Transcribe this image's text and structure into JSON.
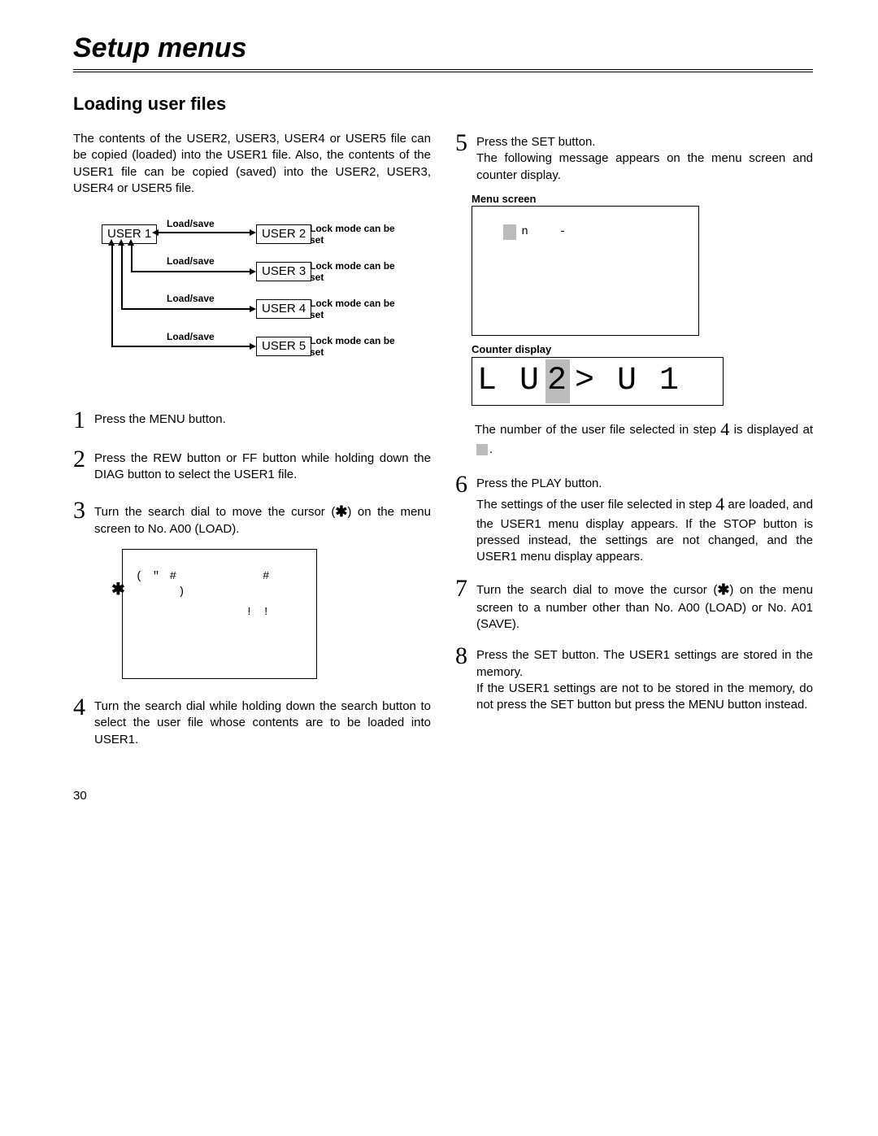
{
  "page_number": "30",
  "header": {
    "title": "Setup menus"
  },
  "section": {
    "title": "Loading user files"
  },
  "intro": "The contents of the USER2, USER3, USER4 or USER5 file can be copied (loaded) into the USER1 file. Also, the contents of the USER1 file can be copied (saved) into the USER2, USER3, USER4 or USER5 file.",
  "diagram": {
    "user1": "USER 1",
    "user2": "USER 2",
    "user3": "USER 3",
    "user4": "USER 4",
    "user5": "USER 5",
    "load_save": "Load/save",
    "lock_mode": "Lock mode can be set"
  },
  "steps_left": {
    "s1": "Press the MENU button.",
    "s2": "Press the REW button or FF button while holding down the DIAG button to select the USER1 file.",
    "s3_pre": "Turn the search dial to move the cursor (",
    "s3_post": ") on the menu screen to No. A00 (LOAD).",
    "s4": "Turn the search dial while holding down the search button to select the user file whose contents are to be loaded into USER1."
  },
  "menu_screen1": {
    "line1": "( \" #          #",
    "line2": "     )",
    "line3": "             ! !"
  },
  "steps_right": {
    "s5a": "Press the SET button.",
    "s5b": "The following message appears on the menu screen and counter display.",
    "menu_screen_label": "Menu screen",
    "menu_screen2_line": "n         ",
    "counter_label": "Counter display",
    "counter_text_pre": "L U",
    "counter_shaded": "2",
    "counter_text_post": "  > U 1",
    "after_counter_pre": "The number of the user file selected in step ",
    "after_counter_step": "4",
    "after_counter_mid": " is displayed at ",
    "after_counter_post": ".",
    "s6a": "Press the PLAY button.",
    "s6b_pre": "The settings of the user file selected in step ",
    "s6b_step": "4",
    "s6b_post": " are loaded, and the USER1 menu display appears. If the STOP button is pressed instead, the settings are not changed, and the USER1 menu display appears.",
    "s7_pre": "Turn the search dial to move the cursor (",
    "s7_post": ") on the menu screen to a number other than No. A00 (LOAD) or No. A01 (SAVE).",
    "s8a": "Press the SET button. The USER1 settings are stored in the memory.",
    "s8b": "If the USER1 settings are not to be stored in the memory, do not press the SET button but press the MENU button instead."
  },
  "symbols": {
    "star": "✱"
  }
}
